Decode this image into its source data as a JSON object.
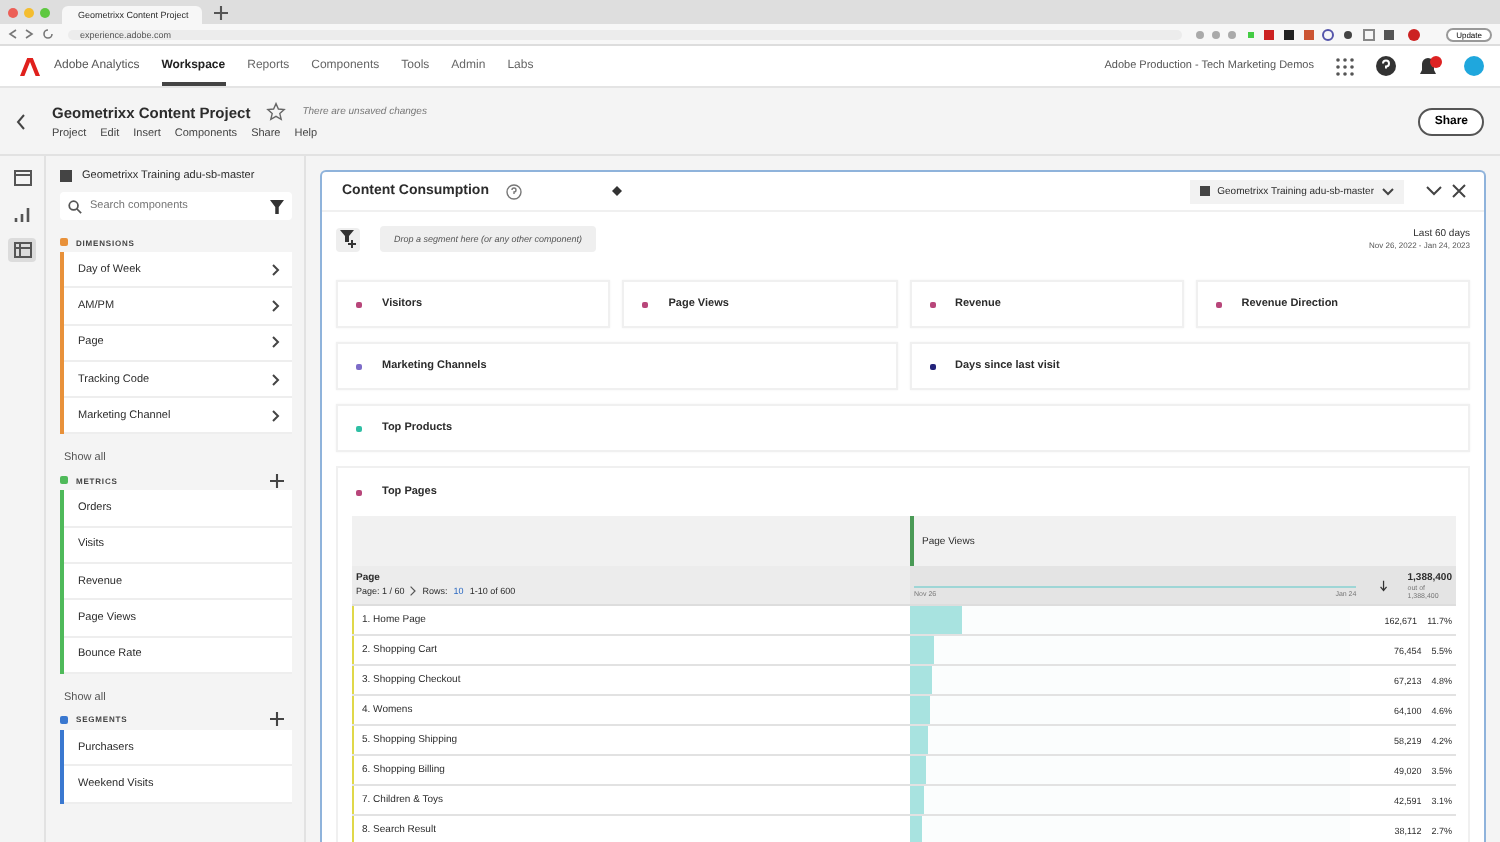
{
  "browser": {
    "tab_title": "Geometrixx Content Project",
    "url": "experience.adobe.com",
    "update_label": "Update"
  },
  "app_nav": {
    "product": "Adobe Analytics",
    "tabs": [
      {
        "label": "Workspace",
        "selected": true
      },
      {
        "label": "Reports",
        "selected": false
      },
      {
        "label": "Components",
        "selected": false
      },
      {
        "label": "Tools",
        "selected": false
      },
      {
        "label": "Admin",
        "selected": false
      },
      {
        "label": "Labs",
        "selected": false
      }
    ],
    "org": "Adobe Production - Tech Marketing Demos"
  },
  "project": {
    "title": "Geometrixx Content Project",
    "status": "There are unsaved changes",
    "menu": [
      "Project",
      "Edit",
      "Insert",
      "Components",
      "Share",
      "Help"
    ],
    "share_label": "Share"
  },
  "rail": [
    {
      "selected": false
    },
    {
      "selected": false
    },
    {
      "selected": true
    }
  ],
  "sidebar": {
    "suite": "Geometrixx Training adu-sb-master",
    "search_placeholder": "Search components",
    "sections": [
      {
        "title": "DIMENSIONS",
        "kind": "dimension",
        "color": "#e8913a",
        "items": [
          "Day of Week",
          "AM/PM",
          "Page",
          "Tracking Code",
          "Marketing Channel"
        ],
        "show_all": "Show all"
      },
      {
        "title": "METRICS",
        "kind": "metric",
        "color": "#4fba5a",
        "items": [
          "Orders",
          "Visits",
          "Revenue",
          "Page Views",
          "Bounce Rate"
        ],
        "show_all": "Show all"
      },
      {
        "title": "SEGMENTS",
        "kind": "segment",
        "color": "#3a78d0",
        "items": [
          "Purchasers",
          "Weekend Visits"
        ]
      }
    ]
  },
  "panel": {
    "title": "Content Consumption",
    "suite": "Geometrixx Training adu-sb-master",
    "drop_zone": "Drop a segment here (or any other component)",
    "date_label": "Last 60 days",
    "date_range": "Nov 26, 2022 - Jan 24, 2023",
    "viz_rows": [
      [
        {
          "title": "Visitors",
          "color": "#b8467a"
        },
        {
          "title": "Page Views",
          "color": "#b8467a"
        },
        {
          "title": "Revenue",
          "color": "#b8467a"
        },
        {
          "title": "Revenue Direction",
          "color": "#b8467a"
        }
      ],
      [
        {
          "title": "Marketing Channels",
          "color": "#7d6cc8"
        },
        {
          "title": "Days since last visit",
          "color": "#23237a"
        }
      ],
      [
        {
          "title": "Top Products",
          "color": "#2fbfa4"
        }
      ]
    ],
    "table": {
      "title": "Top Pages",
      "color": "#b8467a",
      "metric": "Page Views",
      "dimension": "Page",
      "pager": "Page: 1 / 60",
      "rows_label": "Rows:",
      "rows_count": "10",
      "range": "1-10 of 600",
      "spark_start": "Nov 26",
      "spark_end": "Jan 24",
      "total": "1,388,400",
      "total_sub": "out of 1,388,400",
      "rows": [
        {
          "label": "1.  Home Page",
          "value": "162,671",
          "pct": "11.7%",
          "level": 0.117
        },
        {
          "label": "2.  Shopping Cart",
          "value": "76,454",
          "pct": "5.5%",
          "level": 0.055
        },
        {
          "label": "3.  Shopping Checkout",
          "value": "67,213",
          "pct": "4.8%",
          "level": 0.048
        },
        {
          "label": "4.  Womens",
          "value": "64,100",
          "pct": "4.6%",
          "level": 0.046
        },
        {
          "label": "5.  Shopping Shipping",
          "value": "58,219",
          "pct": "4.2%",
          "level": 0.042
        },
        {
          "label": "6.  Shopping Billing",
          "value": "49,020",
          "pct": "3.5%",
          "level": 0.035
        },
        {
          "label": "7.  Children & Toys",
          "value": "42,591",
          "pct": "3.1%",
          "level": 0.031
        },
        {
          "label": "8.  Search Result",
          "value": "38,112",
          "pct": "2.7%",
          "level": 0.027
        }
      ]
    }
  }
}
